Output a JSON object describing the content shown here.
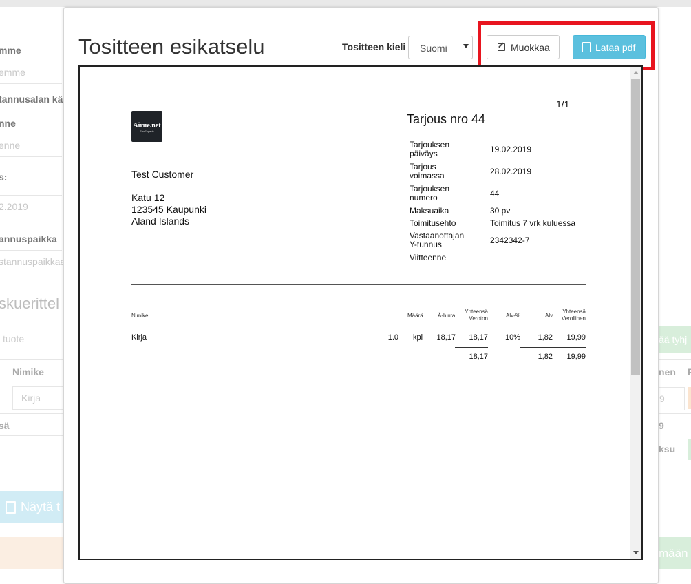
{
  "background": {
    "labels": [
      "mme",
      "tannusalan kää",
      "nne",
      "s:",
      "annuspaikka"
    ],
    "placeholders": [
      "emme",
      "enne",
      "2.2019",
      "stannuspaikkaa"
    ],
    "section_heading": "skuerittel",
    "product_placeholder": "tuote",
    "column_header": "Nimike",
    "row_product": "Kirja",
    "sum_label": "sä",
    "show_button": "Näytä t",
    "right_clip": {
      "empty_button": "ää tyhj",
      "col_header": "nen",
      "col_header2": "F",
      "row_value": "9",
      "sum_value": "9",
      "ksu": "ksu",
      "bottom_button": "mään"
    }
  },
  "modal": {
    "title": "Tositteen esikatselu",
    "language_label": "Tositteen kieli",
    "language_value": "Suomi",
    "edit_button": "Muokkaa",
    "download_button": "Lataa pdf",
    "highlight_color": "#e8151f"
  },
  "document": {
    "page_number": "1/1",
    "logo": {
      "name": "Airue.net",
      "tagline": "SeoExperts"
    },
    "title": "Tarjous nro 44",
    "customer": {
      "name": "Test Customer",
      "street": "Katu 12",
      "city": "123545 Kaupunki",
      "country": "Aland Islands"
    },
    "meta": [
      {
        "label_1": "Tarjouksen",
        "label_2": "päiväys",
        "value": "19.02.2019"
      },
      {
        "label_1": "Tarjous",
        "label_2": "voimassa",
        "value": "28.02.2019"
      },
      {
        "label_1": "Tarjouksen",
        "label_2": "numero",
        "value": "44"
      },
      {
        "label_1": "Maksuaika",
        "label_2": "",
        "value": "30 pv"
      },
      {
        "label_1": "Toimitusehto",
        "label_2": "",
        "value": "Toimitus 7 vrk kuluessa"
      },
      {
        "label_1": "Vastaanottajan",
        "label_2": "Y-tunnus",
        "value": "2342342-7"
      },
      {
        "label_1": "Viitteenne",
        "label_2": "",
        "value": ""
      }
    ],
    "table": {
      "headers": {
        "item": "Nimike",
        "qty": "Määrä",
        "unit_price": "À-hinta",
        "total_ex_1": "Yhteensä",
        "total_ex_2": "Veroton",
        "vat_pct": "Alv-%",
        "vat": "Alv",
        "total_inc_1": "Yhteensä",
        "total_inc_2": "Verollinen"
      },
      "rows": [
        {
          "item": "Kirja",
          "qty": "1.0",
          "unit": "kpl",
          "unit_price": "18,17",
          "total_ex": "18,17",
          "vat_pct": "10%",
          "vat": "1,82",
          "total_inc": "19,99"
        }
      ],
      "totals": {
        "total_ex": "18,17",
        "vat": "1,82",
        "total_inc": "19,99"
      }
    }
  }
}
